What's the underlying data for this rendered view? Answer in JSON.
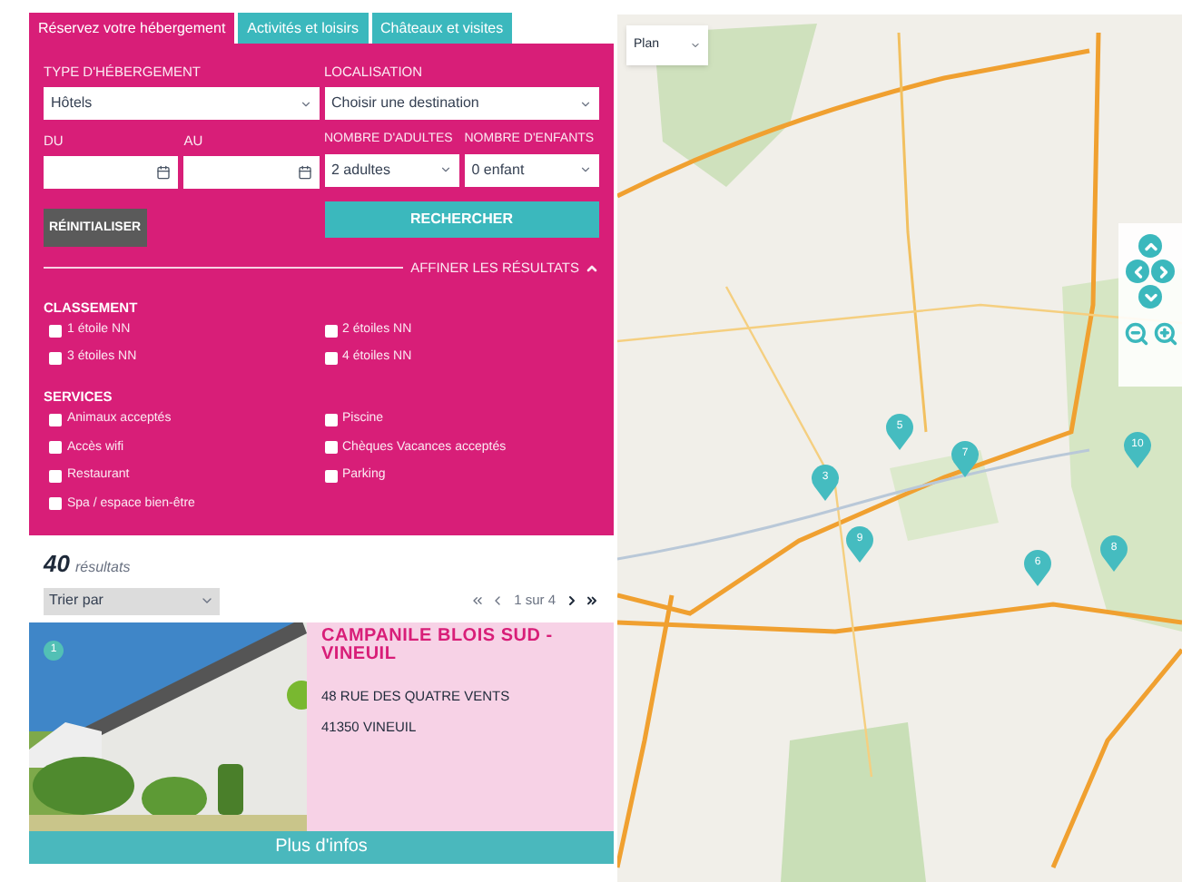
{
  "tabs": [
    {
      "label": "Réservez votre hébergement",
      "selected": true
    },
    {
      "label": "Activités et loisirs",
      "selected": false
    },
    {
      "label": "Châteaux et visites",
      "selected": false
    }
  ],
  "form": {
    "type_label": "TYPE D'HÉBERGEMENT",
    "type_value": "Hôtels",
    "location_label": "LOCALISATION",
    "location_value": "Choisir une destination",
    "du_label": "DU",
    "au_label": "AU",
    "adults_label": "NOMBRE D'ADULTES",
    "adults_value": "2 adultes",
    "children_label": "NOMBRE D'ENFANTS",
    "children_value": "0 enfant",
    "reset_button": "RÉINITIALISER",
    "search_button": "RECHERCHER",
    "refine_link": "AFFINER LES RÉSULTATS",
    "refine_expanded": true
  },
  "filters": [
    {
      "title": "CLASSEMENT",
      "options": [
        {
          "label": "1 étoile NN",
          "checked": false
        },
        {
          "label": "2 étoiles NN",
          "checked": false
        },
        {
          "label": "3 étoiles NN",
          "checked": false
        },
        {
          "label": "4 étoiles NN",
          "checked": false
        }
      ]
    },
    {
      "title": "SERVICES",
      "options": [
        {
          "label": "Animaux acceptés",
          "checked": false
        },
        {
          "label": "Piscine",
          "checked": false
        },
        {
          "label": "Accès wifi",
          "checked": false
        },
        {
          "label": "Chèques Vacances acceptés",
          "checked": false
        },
        {
          "label": "Restaurant",
          "checked": false
        },
        {
          "label": "Parking",
          "checked": false
        },
        {
          "label": "Spa / espace bien-être",
          "checked": false
        }
      ]
    }
  ],
  "results": {
    "count": "40",
    "count_label": "résultats",
    "sort_value": "Trier par",
    "page": "1 sur 4"
  },
  "hotel": {
    "badge": "1",
    "name": "CAMPANILE BLOIS SUD - VINEUIL",
    "address": "48 RUE DES QUATRE VENTS",
    "city": "41350 VINEUIL",
    "button": "Plus d'infos"
  },
  "map": {
    "type_value": "Plan",
    "markers": [
      {
        "label": "5"
      },
      {
        "label": "3"
      },
      {
        "label": "7"
      },
      {
        "label": "9"
      },
      {
        "label": "6"
      },
      {
        "label": "8"
      },
      {
        "label": "10"
      }
    ]
  }
}
